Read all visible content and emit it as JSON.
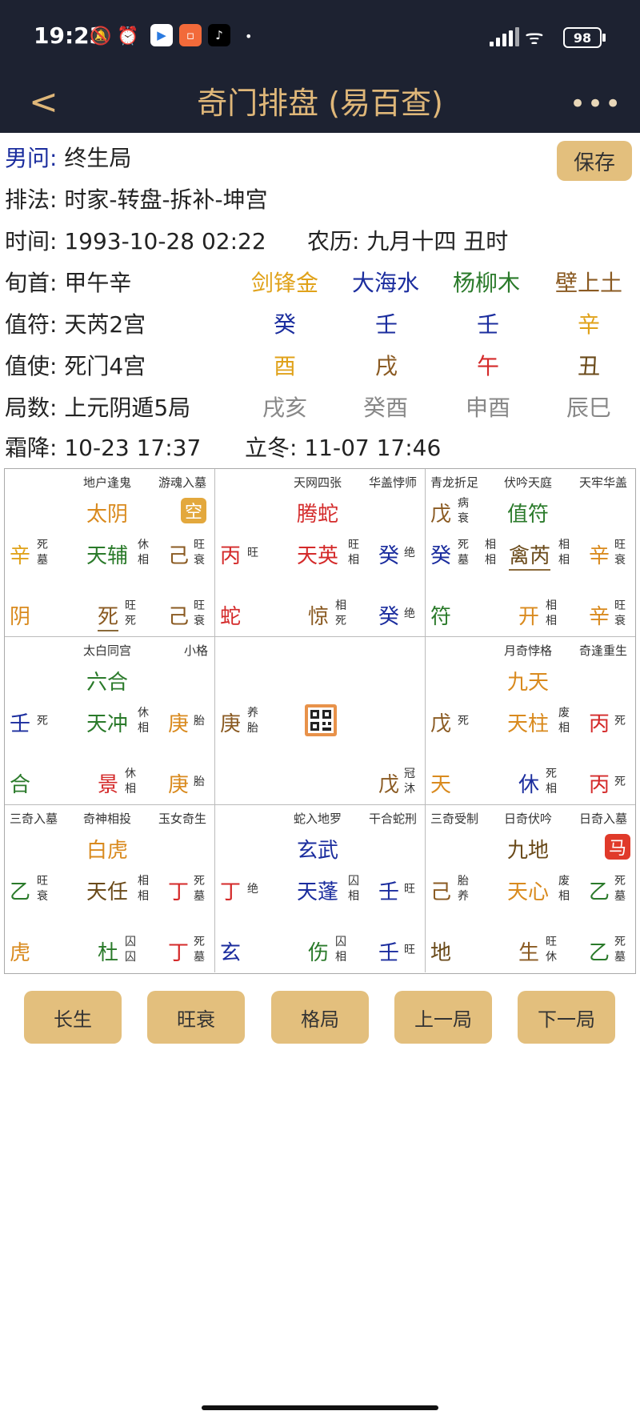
{
  "status_bar": {
    "time": "19:23",
    "battery": "98"
  },
  "header": {
    "back": "<",
    "title": "奇门排盘 (易百查)",
    "more": "•••"
  },
  "info": {
    "gender_label": "男问:",
    "gender_value": "终生局",
    "method_label": "排法:",
    "method_value": "时家-转盘-拆补-坤宫",
    "time_label": "时间:",
    "time_value": "1993-10-28 02:22",
    "lunar_label": "农历:",
    "lunar_value": "九月十四 丑时",
    "xunshou_label": "旬首:",
    "xunshou_value": "甲午辛",
    "zhifu_label": "值符:",
    "zhifu_value": "天芮2宫",
    "zhishi_label": "值使:",
    "zhishi_value": "死门4宫",
    "jushu_label": "局数:",
    "jushu_value": "上元阴遁5局",
    "term1_label": "霜降:",
    "term1_value": "10-23 17:37",
    "term2_label": "立冬:",
    "term2_value": "11-07 17:46",
    "save_label": "保存"
  },
  "pillars": [
    {
      "nayin": "剑锋金",
      "stem": "癸",
      "branch": "酉",
      "kong": "戌亥"
    },
    {
      "nayin": "大海水",
      "stem": "壬",
      "branch": "戌",
      "kong": "癸酉"
    },
    {
      "nayin": "杨柳木",
      "stem": "壬",
      "branch": "午",
      "kong": "申酉"
    },
    {
      "nayin": "壁上土",
      "stem": "辛",
      "branch": "丑",
      "kong": "辰巳"
    }
  ],
  "colors": {
    "gold": "#e0a21a",
    "blue": "#1b2d9e",
    "green": "#2a7a2a",
    "brown": "#8a5a22",
    "red": "#d42a2a",
    "button": "#e3bf7d",
    "nav": "#1d2231"
  },
  "palaces": {
    "p0": {
      "n1": "地户逢鬼",
      "n2": "游魂入墓",
      "god": "太阴",
      "badge": "空",
      "ls": "辛",
      "ls1": "死",
      "ls2": "墓",
      "star": "天辅",
      "st1": "休",
      "st2": "相",
      "rs": "己",
      "rs1": "旺",
      "rs2": "衰",
      "bl": "阴",
      "door": "死",
      "dr1": "旺",
      "dr2": "死",
      "br": "己",
      "br1": "旺",
      "br2": "衰"
    },
    "p1": {
      "n1": "天网四张",
      "n2": "华盖悖师",
      "god": "腾蛇",
      "ls": "丙",
      "ls1": "旺",
      "star": "天英",
      "st1": "旺",
      "st2": "相",
      "rs": "癸",
      "rs1": "绝",
      "bl": "蛇",
      "door": "惊",
      "dr1": "相",
      "dr2": "死",
      "br": "癸",
      "br1": "绝"
    },
    "p2": {
      "n0": "青龙折足",
      "n1": "伏吟天庭",
      "n2": "天牢华盖",
      "top": "戊",
      "top1": "病",
      "top2": "衰",
      "god": "值符",
      "ls": "癸",
      "ls1": "死",
      "ls2": "墓",
      "lx1": "相",
      "lx2": "相",
      "star": "禽芮",
      "st1": "相",
      "st2": "相",
      "rs": "辛",
      "rs1": "旺",
      "rs2": "衰",
      "bl": "符",
      "door": "开",
      "dr1": "相",
      "dr2": "相",
      "br": "辛",
      "br1": "旺",
      "br2": "衰"
    },
    "p3": {
      "n1": "太白同宫",
      "n2": "小格",
      "god": "六合",
      "ls": "壬",
      "ls1": "死",
      "star": "天冲",
      "st1": "休",
      "st2": "相",
      "rs": "庚",
      "rs1": "胎",
      "bl": "合",
      "door": "景",
      "dr1": "休",
      "dr2": "相",
      "br": "庚",
      "br1": "胎"
    },
    "p4": {
      "ls": "庚",
      "ls1": "养",
      "ls2": "胎",
      "br": "戊",
      "br1": "冠",
      "br2": "沐"
    },
    "p5": {
      "n1": "月奇悖格",
      "n2": "奇逢重生",
      "god": "九天",
      "ls": "戊",
      "ls1": "死",
      "star": "天柱",
      "st1": "废",
      "st2": "相",
      "rs": "丙",
      "rs1": "死",
      "bl": "天",
      "door": "休",
      "dr1": "死",
      "dr2": "相",
      "br": "丙",
      "br1": "死"
    },
    "p6": {
      "n0": "三奇入墓",
      "n1": "奇神相投",
      "n2": "玉女奇生",
      "god": "白虎",
      "ls": "乙",
      "ls1": "旺",
      "ls2": "衰",
      "star": "天任",
      "st1": "相",
      "st2": "相",
      "rs": "丁",
      "rs1": "死",
      "rs2": "墓",
      "bl": "虎",
      "door": "杜",
      "dr1": "囚",
      "dr2": "囚",
      "br": "丁",
      "br1": "死",
      "br2": "墓"
    },
    "p7": {
      "n1": "蛇入地罗",
      "n2": "干合蛇刑",
      "god": "玄武",
      "ls": "丁",
      "ls1": "绝",
      "star": "天蓬",
      "st1": "囚",
      "st2": "相",
      "rs": "壬",
      "rs1": "旺",
      "bl": "玄",
      "door": "伤",
      "dr1": "囚",
      "dr2": "相",
      "br": "壬",
      "br1": "旺"
    },
    "p8": {
      "n0": "三奇受制",
      "n1": "日奇伏吟",
      "n2": "日奇入墓",
      "god": "九地",
      "badge": "马",
      "ls": "己",
      "ls1": "胎",
      "ls2": "养",
      "star": "天心",
      "st1": "废",
      "st2": "相",
      "rs": "乙",
      "rs1": "死",
      "rs2": "墓",
      "bl": "地",
      "door": "生",
      "dr1": "旺",
      "dr2": "休",
      "br": "乙",
      "br1": "死",
      "br2": "墓"
    }
  },
  "buttons": {
    "b1": "长生",
    "b2": "旺衰",
    "b3": "格局",
    "b4": "上一局",
    "b5": "下一局"
  }
}
